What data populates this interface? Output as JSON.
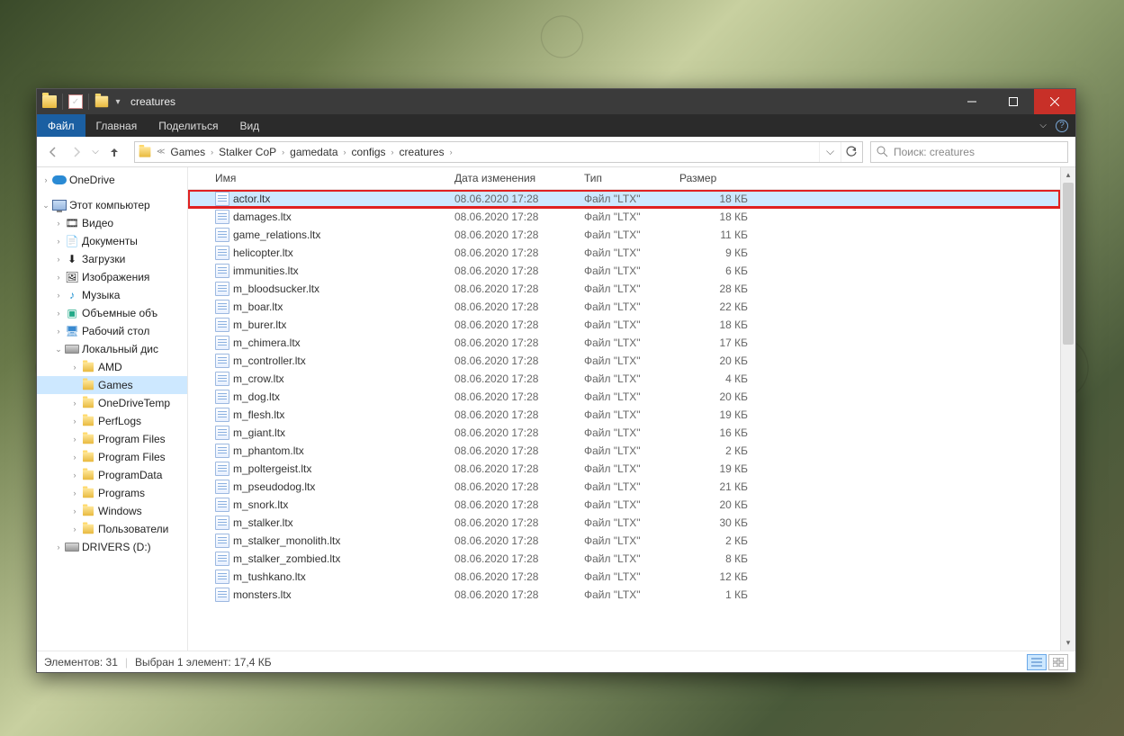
{
  "title": "creatures",
  "ribbon_tabs": {
    "file": "Файл",
    "home": "Главная",
    "share": "Поделиться",
    "view": "Вид"
  },
  "breadcrumbs": [
    "Games",
    "Stalker CoP",
    "gamedata",
    "configs",
    "creatures"
  ],
  "search_placeholder": "Поиск: creatures",
  "columns": {
    "name": "Имя",
    "date": "Дата изменения",
    "type": "Тип",
    "size": "Размер"
  },
  "navpane": {
    "onedrive": "OneDrive",
    "this_pc": "Этот компьютер",
    "libs": {
      "video": "Видео",
      "documents": "Документы",
      "downloads": "Загрузки",
      "pictures": "Изображения",
      "music": "Музыка",
      "objects3d": "Объемные объ",
      "desktop": "Рабочий стол"
    },
    "localdisk": "Локальный дис",
    "folders": [
      "AMD",
      "Games",
      "OneDriveTemp",
      "PerfLogs",
      "Program Files",
      "Program Files",
      "ProgramData",
      "Programs",
      "Windows",
      "Пользователи"
    ],
    "drivers_d": "DRIVERS (D:)"
  },
  "files": [
    {
      "name": "actor.ltx",
      "date": "08.06.2020 17:28",
      "type": "Файл \"LTX\"",
      "size": "18 КБ",
      "hl": true,
      "sel": true
    },
    {
      "name": "damages.ltx",
      "date": "08.06.2020 17:28",
      "type": "Файл \"LTX\"",
      "size": "18 КБ"
    },
    {
      "name": "game_relations.ltx",
      "date": "08.06.2020 17:28",
      "type": "Файл \"LTX\"",
      "size": "11 КБ"
    },
    {
      "name": "helicopter.ltx",
      "date": "08.06.2020 17:28",
      "type": "Файл \"LTX\"",
      "size": "9 КБ"
    },
    {
      "name": "immunities.ltx",
      "date": "08.06.2020 17:28",
      "type": "Файл \"LTX\"",
      "size": "6 КБ"
    },
    {
      "name": "m_bloodsucker.ltx",
      "date": "08.06.2020 17:28",
      "type": "Файл \"LTX\"",
      "size": "28 КБ"
    },
    {
      "name": "m_boar.ltx",
      "date": "08.06.2020 17:28",
      "type": "Файл \"LTX\"",
      "size": "22 КБ"
    },
    {
      "name": "m_burer.ltx",
      "date": "08.06.2020 17:28",
      "type": "Файл \"LTX\"",
      "size": "18 КБ"
    },
    {
      "name": "m_chimera.ltx",
      "date": "08.06.2020 17:28",
      "type": "Файл \"LTX\"",
      "size": "17 КБ"
    },
    {
      "name": "m_controller.ltx",
      "date": "08.06.2020 17:28",
      "type": "Файл \"LTX\"",
      "size": "20 КБ"
    },
    {
      "name": "m_crow.ltx",
      "date": "08.06.2020 17:28",
      "type": "Файл \"LTX\"",
      "size": "4 КБ"
    },
    {
      "name": "m_dog.ltx",
      "date": "08.06.2020 17:28",
      "type": "Файл \"LTX\"",
      "size": "20 КБ"
    },
    {
      "name": "m_flesh.ltx",
      "date": "08.06.2020 17:28",
      "type": "Файл \"LTX\"",
      "size": "19 КБ"
    },
    {
      "name": "m_giant.ltx",
      "date": "08.06.2020 17:28",
      "type": "Файл \"LTX\"",
      "size": "16 КБ"
    },
    {
      "name": "m_phantom.ltx",
      "date": "08.06.2020 17:28",
      "type": "Файл \"LTX\"",
      "size": "2 КБ"
    },
    {
      "name": "m_poltergeist.ltx",
      "date": "08.06.2020 17:28",
      "type": "Файл \"LTX\"",
      "size": "19 КБ"
    },
    {
      "name": "m_pseudodog.ltx",
      "date": "08.06.2020 17:28",
      "type": "Файл \"LTX\"",
      "size": "21 КБ"
    },
    {
      "name": "m_snork.ltx",
      "date": "08.06.2020 17:28",
      "type": "Файл \"LTX\"",
      "size": "20 КБ"
    },
    {
      "name": "m_stalker.ltx",
      "date": "08.06.2020 17:28",
      "type": "Файл \"LTX\"",
      "size": "30 КБ"
    },
    {
      "name": "m_stalker_monolith.ltx",
      "date": "08.06.2020 17:28",
      "type": "Файл \"LTX\"",
      "size": "2 КБ"
    },
    {
      "name": "m_stalker_zombied.ltx",
      "date": "08.06.2020 17:28",
      "type": "Файл \"LTX\"",
      "size": "8 КБ"
    },
    {
      "name": "m_tushkano.ltx",
      "date": "08.06.2020 17:28",
      "type": "Файл \"LTX\"",
      "size": "12 КБ"
    },
    {
      "name": "monsters.ltx",
      "date": "08.06.2020 17:28",
      "type": "Файл \"LTX\"",
      "size": "1 КБ"
    }
  ],
  "status": {
    "count_label": "Элементов: 31",
    "selected_label": "Выбран 1 элемент: 17,4 КБ"
  }
}
